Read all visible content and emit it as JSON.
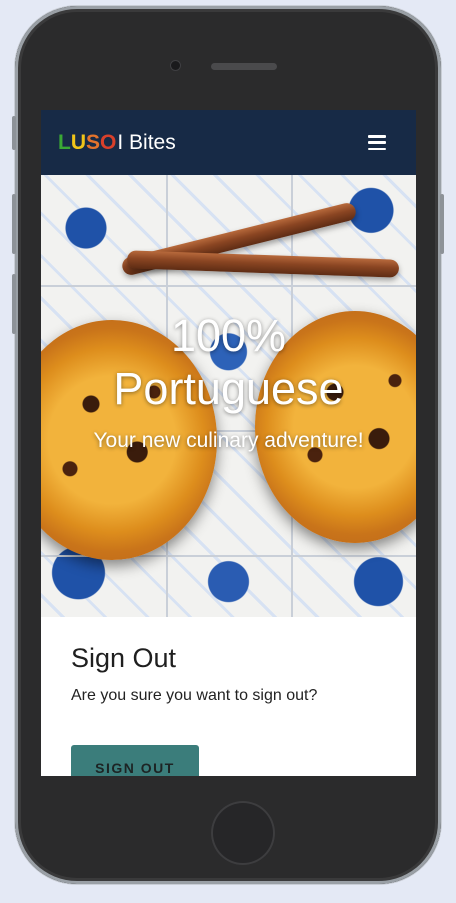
{
  "brand": {
    "letters": [
      "L",
      "U",
      "S",
      "O"
    ],
    "rest": "I Bites",
    "colors": [
      "#3aa835",
      "#f0c419",
      "#e3732c",
      "#d9402b"
    ]
  },
  "nav": {
    "menu_icon": "hamburger-menu-icon"
  },
  "hero": {
    "title_line1": "100%",
    "title_line2": "Portuguese",
    "subtitle": "Your new culinary adventure!"
  },
  "signout": {
    "heading": "Sign Out",
    "prompt": "Are you sure you want to sign out?",
    "button_label": "SIGN OUT"
  },
  "colors": {
    "navbar": "#172a46",
    "button": "#3b7d7b"
  }
}
